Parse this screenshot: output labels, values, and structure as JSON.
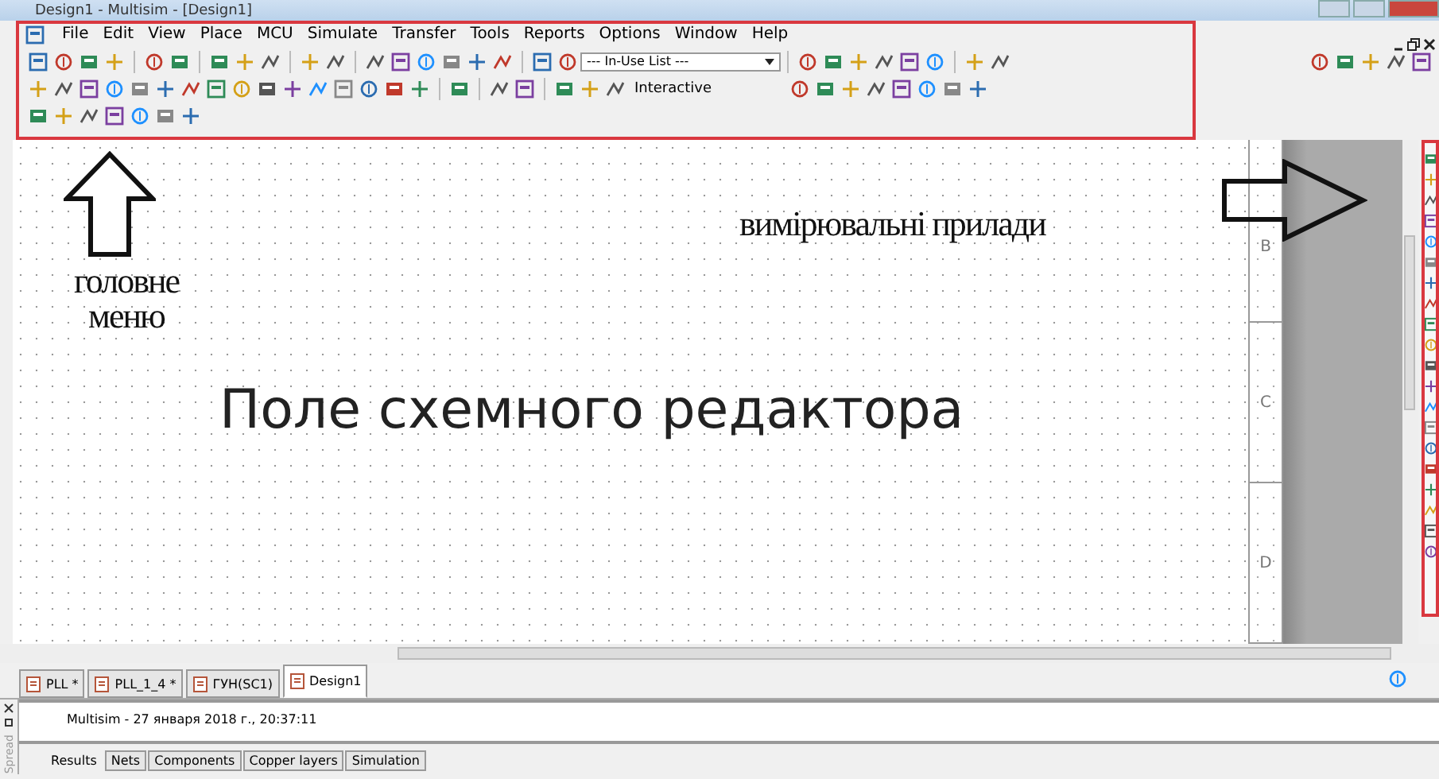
{
  "window": {
    "title": "Design1 - Multisim - [Design1]"
  },
  "menu": [
    "File",
    "Edit",
    "View",
    "Place",
    "MCU",
    "Simulate",
    "Transfer",
    "Tools",
    "Reports",
    "Options",
    "Window",
    "Help"
  ],
  "toolbar": {
    "in_use_list": {
      "value": "--- In-Use List ---"
    },
    "simulate_mode": "Interactive"
  },
  "canvas": {
    "border_letters": [
      "B",
      "C",
      "D"
    ]
  },
  "annotations": {
    "main_menu": "головне меню",
    "instruments": "вимірювальні прилади",
    "editor_field": "Поле схемного редактора"
  },
  "design_tabs": [
    {
      "label": "PLL *",
      "selected": false
    },
    {
      "label": "PLL_1_4 *",
      "selected": false
    },
    {
      "label": "ГУН(SC1)",
      "selected": false
    },
    {
      "label": "Design1",
      "selected": true
    }
  ],
  "spreadsheet": {
    "side_label": "Spread",
    "log": "Multisim  -  27 января 2018 г., 20:37:11",
    "tabs": [
      {
        "label": "Results",
        "selected": true
      },
      {
        "label": "Nets",
        "selected": false
      },
      {
        "label": "Components",
        "selected": false
      },
      {
        "label": "Copper layers",
        "selected": false
      },
      {
        "label": "Simulation",
        "selected": false
      }
    ]
  }
}
